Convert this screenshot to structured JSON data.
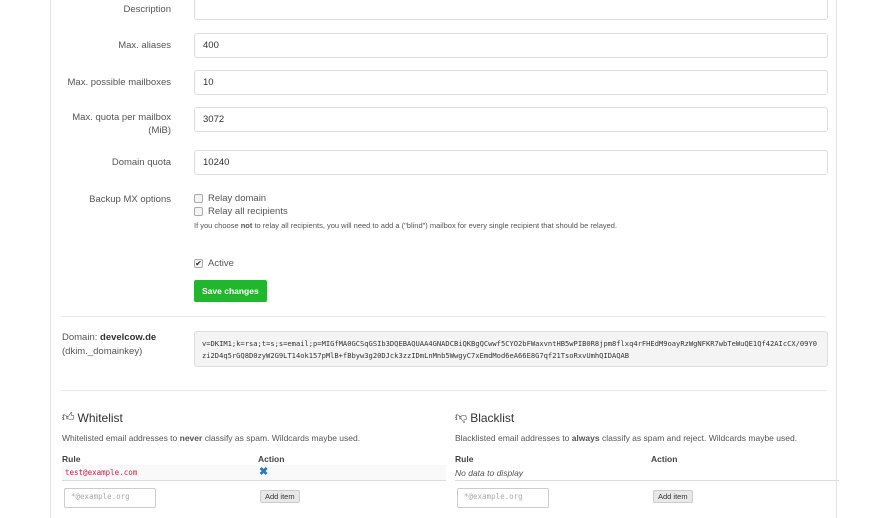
{
  "form": {
    "description": {
      "label": "Description",
      "value": ""
    },
    "max_aliases": {
      "label": "Max. aliases",
      "value": "400"
    },
    "max_mailboxes": {
      "label": "Max. possible mailboxes",
      "value": "10"
    },
    "max_quota": {
      "label": "Max. quota per mailbox (MiB)",
      "value": "3072"
    },
    "domain_quota": {
      "label": "Domain quota",
      "value": "10240"
    },
    "backup_mx": {
      "label": "Backup MX options",
      "relay_domain": "Relay domain",
      "relay_all": "Relay all recipients",
      "help_pre": "If you choose ",
      "help_bold": "not",
      "help_post": " to relay all recipients, you will need to add a (\"blind\") mailbox for every single recipient that should be relayed."
    },
    "active": {
      "label": "Active",
      "checked": true
    },
    "save": "Save changes"
  },
  "dkim": {
    "prefix": "Domain: ",
    "domain": "develcow.de",
    "selector": "(dkim._domainkey)",
    "record": "v=DKIM1;k=rsa;t=s;s=email;p=MIGfMA0GCSqGSIb3DQEBAQUAA4GNADCBiQKBgQCwwf5CYO2bFWaxvntHB5wPIB0R8jpm8flxq4rFHEdM9oayRzWgNFKR7wbTeWuQE1Qf42AIcCX/09Y0zi2D4q5rGQ8D0zyW2G9LT14ok157pMlB+fBbyw3g20DJck3zzIDmLnMnb5WwgyC7xEmdMod6eA66E8G7qf21TsoRxvUmhQIDAQAB"
  },
  "whitelist": {
    "title": "Whitelist",
    "desc_pre": "Whitelisted email addresses to ",
    "desc_bold": "never",
    "desc_post": " classify as spam. Wildcards maybe used.",
    "col_rule": "Rule",
    "col_action": "Action",
    "rows": [
      "test@example.com"
    ],
    "placeholder": "*@example.org",
    "add": "Add item"
  },
  "blacklist": {
    "title": "Blacklist",
    "desc_pre": "Blacklisted email addresses to ",
    "desc_bold": "always",
    "desc_post": " classify as spam and reject. Wildcards maybe used.",
    "col_rule": "Rule",
    "col_action": "Action",
    "empty": "No data to display",
    "placeholder": "*@example.org",
    "add": "Add item"
  }
}
